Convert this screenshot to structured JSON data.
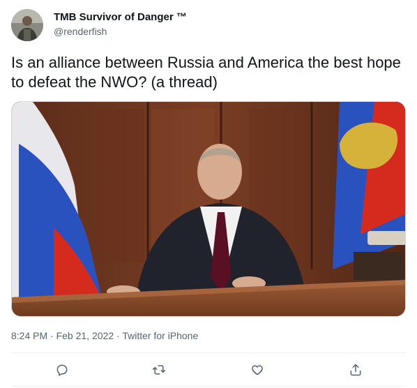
{
  "author": {
    "display_name": "TMB Survivor of Danger ™",
    "handle": "@renderfish"
  },
  "tweet": {
    "text": "Is an alliance between Russia and America the best hope to defeat the NWO? (a thread)",
    "media_icon": "photo-of-man-at-desk-with-flags"
  },
  "meta": {
    "time": "8:24 PM",
    "separator_1": " · ",
    "date": "Feb 21, 2022",
    "separator_2": " · ",
    "source": "Twitter for iPhone"
  },
  "actions": [
    {
      "icon": "reply-icon"
    },
    {
      "icon": "retweet-icon"
    },
    {
      "icon": "like-icon"
    },
    {
      "icon": "share-icon"
    }
  ],
  "colors": {
    "text_primary": "#0f1419",
    "text_secondary": "#536471",
    "divider": "#eff3f4"
  }
}
